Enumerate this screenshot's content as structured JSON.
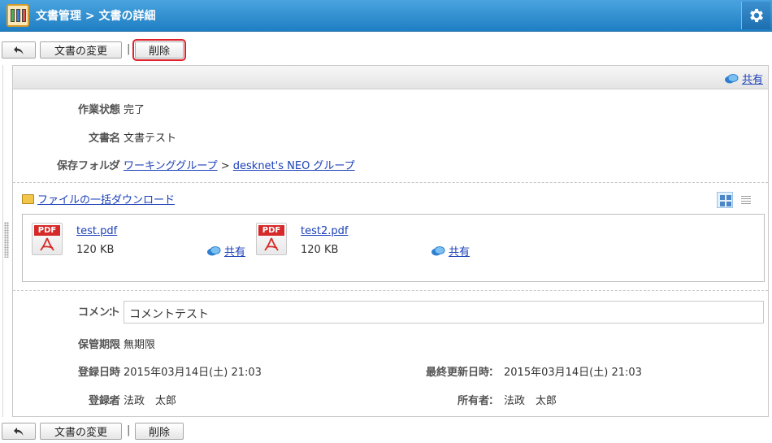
{
  "header": {
    "title": "文書管理 > 文書の詳細",
    "app_icon": "binders-icon",
    "settings_icon": "gear-icon"
  },
  "toolbar": {
    "back_icon": "back-arrow-icon",
    "edit_label": "文書の変更",
    "separator": "|",
    "delete_label": "削除"
  },
  "panel": {
    "share_label": "共有"
  },
  "fields": {
    "status_label": "作業状態",
    "status_value": "完了",
    "name_label": "文書名",
    "name_value": "文書テスト",
    "folder_label": "保存フォルダ",
    "folder_path": [
      "ワーキンググループ",
      "desknet's NEO グループ"
    ],
    "folder_sep": ">",
    "colon": "："
  },
  "files": {
    "bulk_download_label": "ファイルの一括ダウンロード",
    "items": [
      {
        "name": "test.pdf",
        "size": "120 KB",
        "share": "共有",
        "tag": "PDF"
      },
      {
        "name": "test2.pdf",
        "size": "120 KB",
        "share": "共有",
        "tag": "PDF"
      }
    ]
  },
  "comment": {
    "label": "コメント",
    "value": "コメントテスト"
  },
  "meta": {
    "retention_label": "保管期限",
    "retention_value": "無期限",
    "registered_label": "登録日時",
    "registered_value": "2015年03月14日(土) 21:03",
    "updated_label": "最終更新日時",
    "updated_value": "2015年03月14日(土) 21:03",
    "registrant_label": "登録者",
    "registrant_value": "法政　太郎",
    "owner_label": "所有者",
    "owner_value": "法政　太郎"
  },
  "colors": {
    "header_blue": "#2a8ad0",
    "link": "#1a3fb8",
    "highlight_red": "#e0202a",
    "pdf_red": "#d62a2a"
  }
}
